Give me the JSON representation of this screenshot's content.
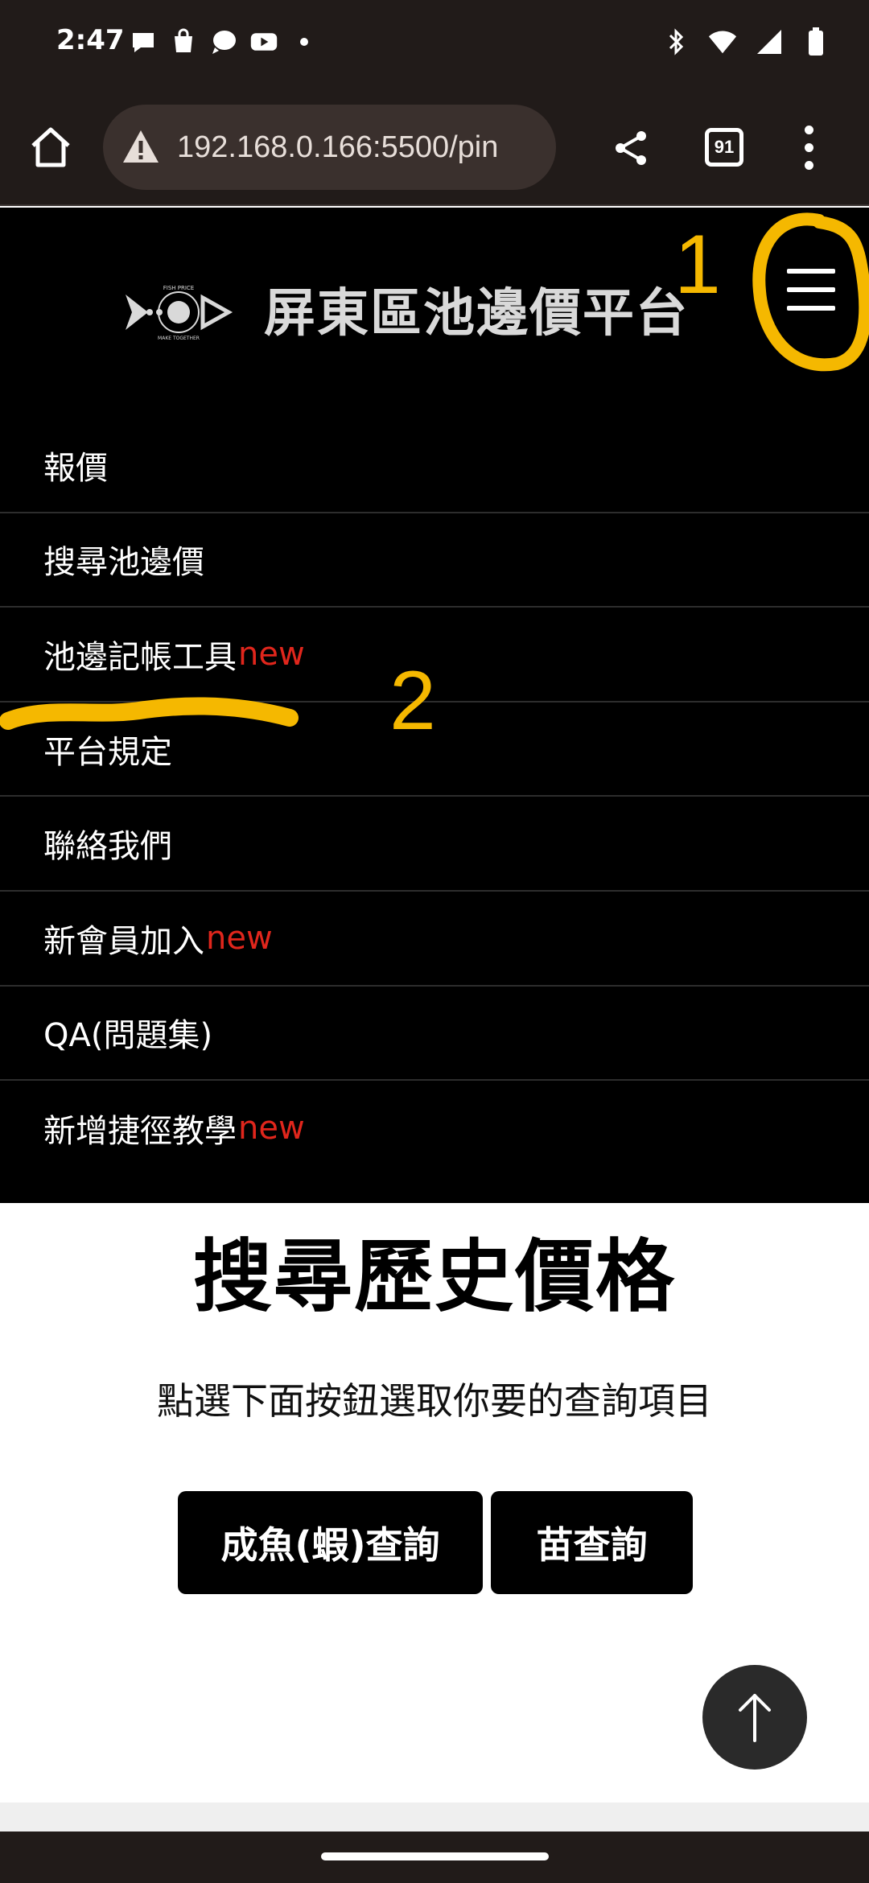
{
  "status_bar": {
    "time": "2:47",
    "left_icons": [
      "chat-bubble-icon",
      "shopping-bag-icon",
      "messenger-icon",
      "youtube-icon",
      "dot-icon"
    ],
    "right_icons": [
      "bluetooth-icon",
      "wifi-icon",
      "signal-icon",
      "battery-icon"
    ]
  },
  "browser": {
    "url": "192.168.0.166:5500/pin",
    "tab_count": "91"
  },
  "header": {
    "logo_text_top": "FISH PRICE",
    "logo_text_bottom": "MAKE TOGETHER",
    "title": "屏東區池邊價平台"
  },
  "nav": {
    "items": [
      {
        "label": "報價",
        "badge": ""
      },
      {
        "label": "搜尋池邊價",
        "badge": ""
      },
      {
        "label": "池邊記帳工具",
        "badge": "new"
      },
      {
        "label": "平台規定",
        "badge": ""
      },
      {
        "label": "聯絡我們",
        "badge": ""
      },
      {
        "label": "新會員加入",
        "badge": "new"
      },
      {
        "label": "QA(問題集)",
        "badge": ""
      },
      {
        "label": "新增捷徑教學",
        "badge": "new"
      }
    ]
  },
  "main": {
    "title": "搜尋歷史價格",
    "subtitle": "點選下面按鈕選取你要的查詢項目",
    "buttons": {
      "adult": "成魚(蝦)查詢",
      "fry": "苗查詢"
    },
    "to_top_icon": "arrow-up-icon"
  },
  "annotations": {
    "marker_1": "1",
    "marker_2": "2",
    "color": "#f5b800"
  },
  "colors": {
    "new_badge": "#e0261c",
    "header_bg": "#000000",
    "browser_bg": "#211b19"
  }
}
